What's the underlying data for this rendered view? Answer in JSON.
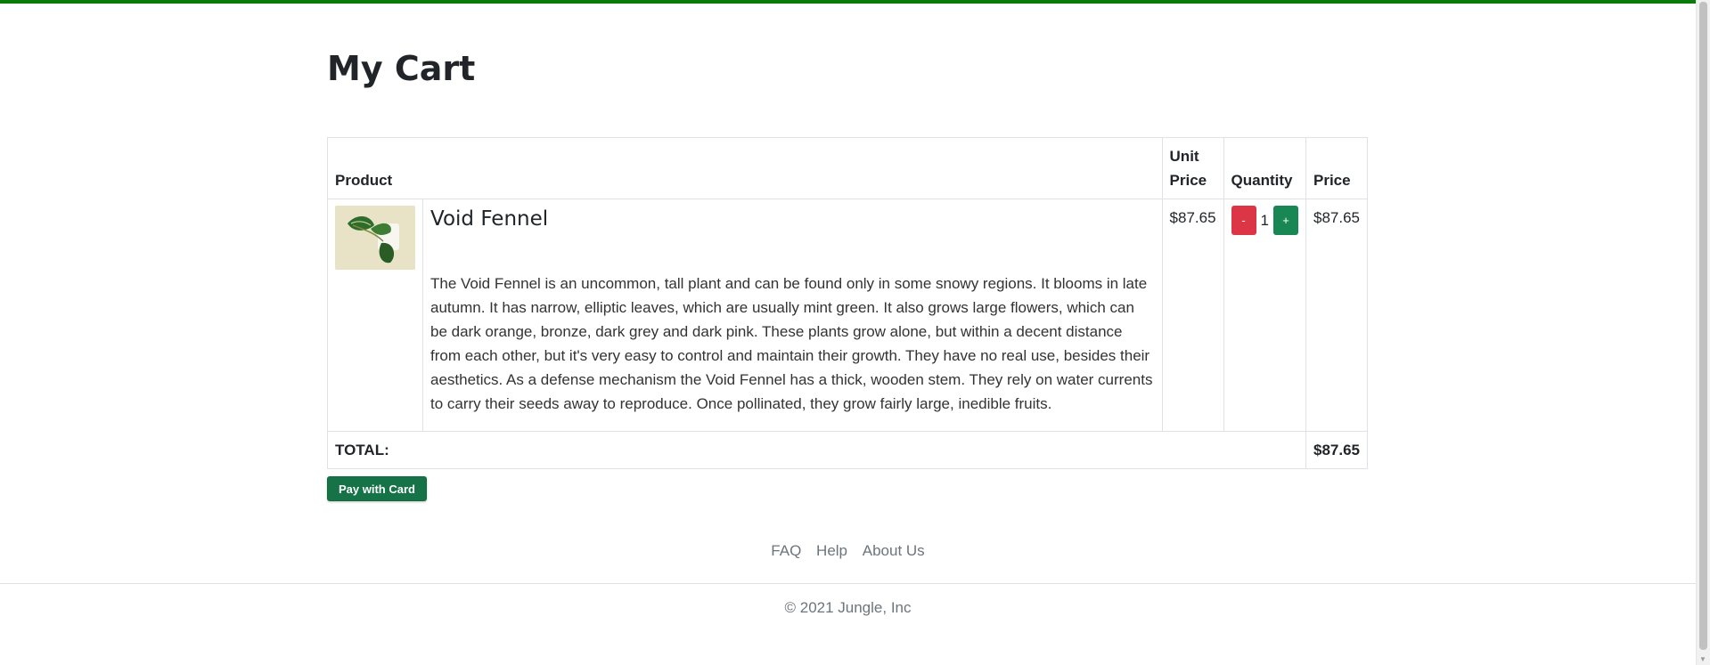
{
  "page": {
    "title": "My Cart"
  },
  "table": {
    "headers": {
      "product": "Product",
      "unit_price": "Unit Price",
      "quantity": "Quantity",
      "price": "Price"
    },
    "items": [
      {
        "name": "Void Fennel",
        "description": "The Void Fennel is an uncommon, tall plant and can be found only in some snowy regions. It blooms in late autumn. It has narrow, elliptic leaves, which are usually mint green. It also grows large flowers, which can be dark orange, bronze, dark grey and dark pink. These plants grow alone, but within a decent distance from each other, but it's very easy to control and maintain their growth. They have no real use, besides their aesthetics. As a defense mechanism the Void Fennel has a thick, wooden stem. They rely on water currents to carry their seeds away to reproduce. Once pollinated, they grow fairly large, inedible fruits.",
        "unit_price": "$87.65",
        "quantity": "1",
        "decrement_label": "-",
        "increment_label": "+",
        "price": "$87.65"
      }
    ],
    "total_label": "TOTAL:",
    "total_value": "$87.65"
  },
  "pay_button": {
    "label": "Pay with Card"
  },
  "footer": {
    "links": [
      "FAQ",
      "Help",
      "About Us"
    ],
    "copyright": "© 2021 Jungle, Inc"
  },
  "colors": {
    "accent": "#0a7a0a",
    "minus": "#dc3545",
    "plus": "#198754",
    "pay": "#157347"
  }
}
